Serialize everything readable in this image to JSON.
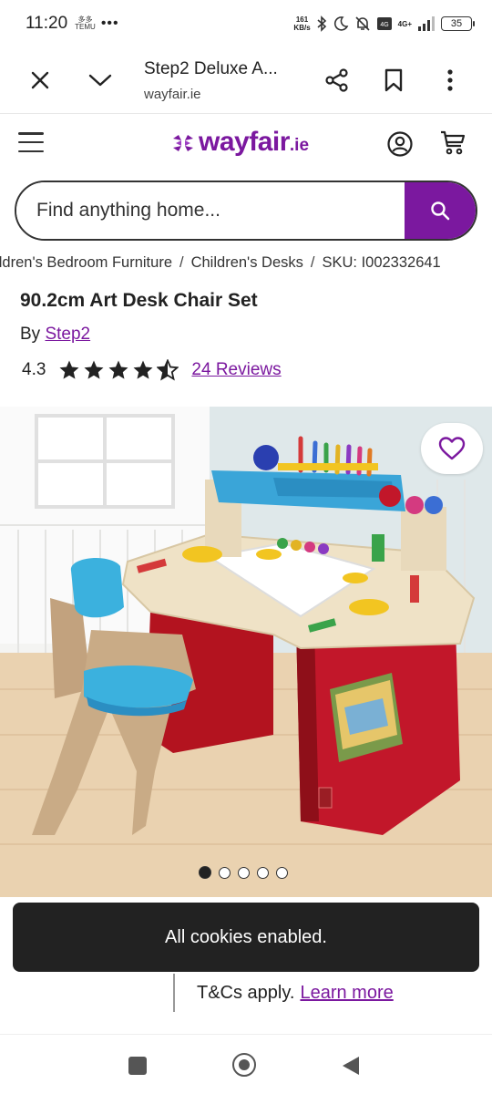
{
  "status_bar": {
    "time": "11:20",
    "app_badge_top": "多多",
    "app_badge_bottom": "TEMU",
    "more_dots": "•••",
    "net_speed_value": "161",
    "net_speed_unit": "KB/s",
    "network": "4G+",
    "battery": "35"
  },
  "browser": {
    "page_title": "Step2 Deluxe A...",
    "url": "wayfair.ie",
    "icons": [
      "close-icon",
      "chevron-down-icon",
      "share-icon",
      "bookmark-icon",
      "more-vert-icon"
    ]
  },
  "site": {
    "logo_text": "wayfair",
    "logo_tld": ".ie",
    "brand_color": "#7b189f"
  },
  "search": {
    "placeholder": "Find anything home..."
  },
  "breadcrumb": {
    "items": [
      "Children's Bedroom Furniture",
      "Children's Desks",
      "SKU: I002332641"
    ],
    "separator": "/"
  },
  "product": {
    "title": "90.2cm Art Desk Chair Set",
    "by_prefix": "By",
    "brand": "Step2",
    "rating": "4.3",
    "rating_value": 4.3,
    "rating_max": 5,
    "reviews_label": "24 Reviews"
  },
  "carousel": {
    "total": 5,
    "active": 1
  },
  "toast": {
    "message": "All cookies enabled."
  },
  "promo": {
    "text": "T&Cs apply.",
    "link": "Learn more"
  }
}
